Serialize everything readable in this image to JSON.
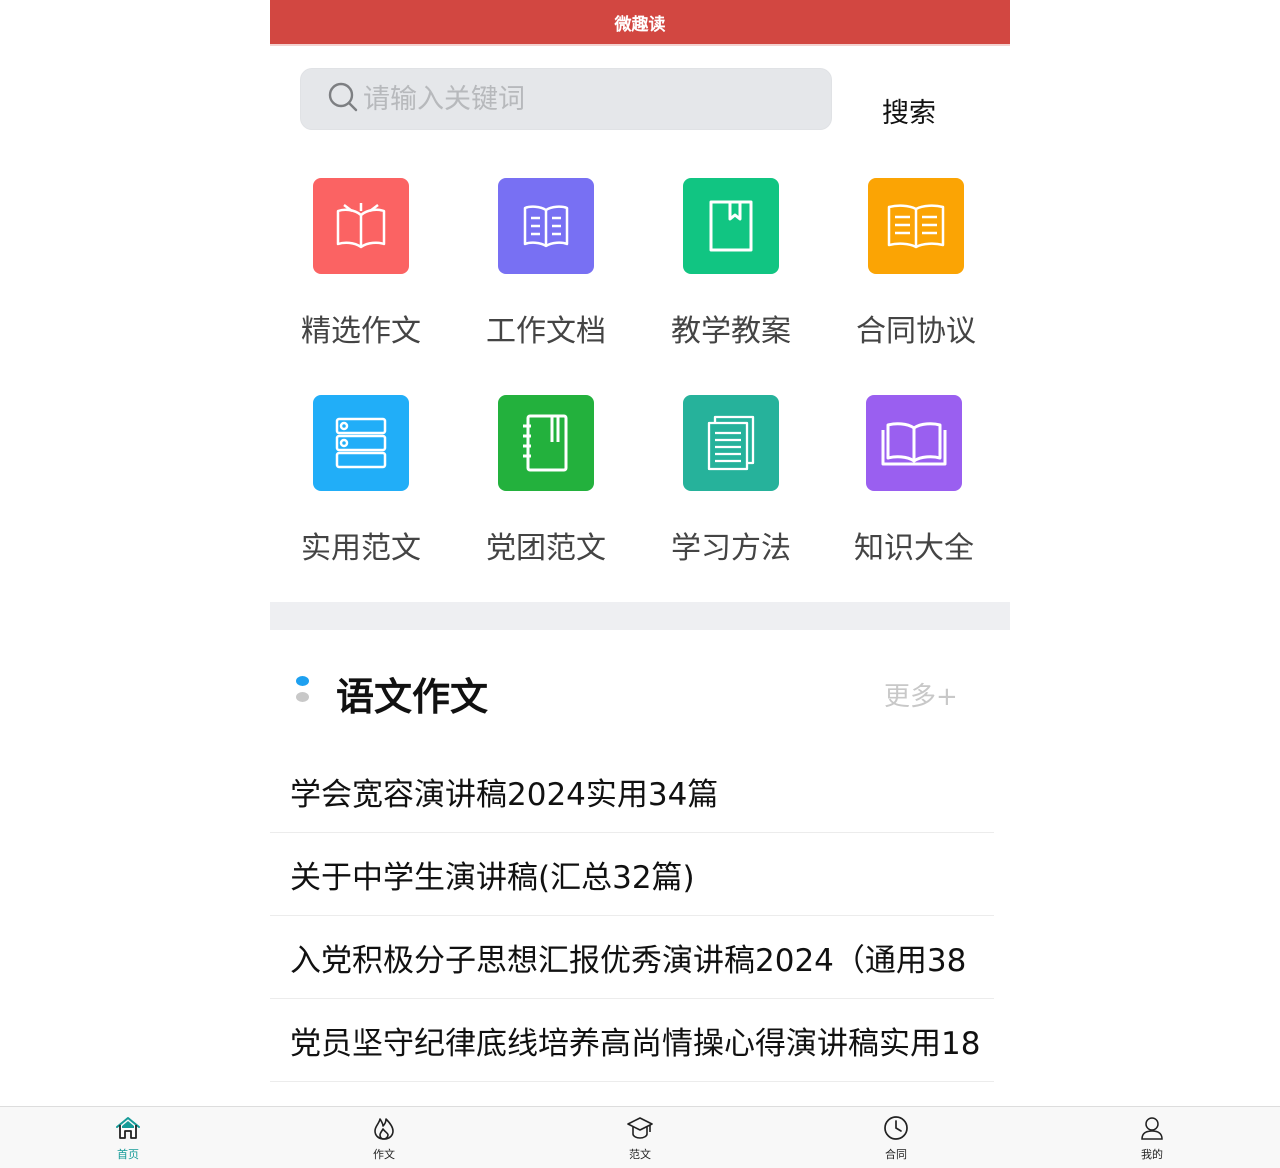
{
  "header": {
    "title": "微趣读"
  },
  "search": {
    "placeholder": "请输入关键词",
    "value": "",
    "button_label": "搜索"
  },
  "categories": [
    {
      "label": "精选作文",
      "icon": "open-book-icon",
      "color": "#fb6363"
    },
    {
      "label": "工作文档",
      "icon": "document-icon",
      "color": "#7870f3"
    },
    {
      "label": "教学教案",
      "icon": "bookmark-book-icon",
      "color": "#11c582"
    },
    {
      "label": "合同协议",
      "icon": "book-lines-icon",
      "color": "#fba404"
    },
    {
      "label": "实用范文",
      "icon": "server-list-icon",
      "color": "#21aef8"
    },
    {
      "label": "党团范文",
      "icon": "notebook-icon",
      "color": "#23b13d"
    },
    {
      "label": "学习方法",
      "icon": "paper-stack-icon",
      "color": "#26b29b"
    },
    {
      "label": "知识大全",
      "icon": "open-book-icon",
      "color": "#9a5ff0"
    }
  ],
  "section": {
    "title": "语文作文",
    "more_label": "更多+",
    "dot_colors": [
      "#1ea0f0",
      "#c8c8c8"
    ]
  },
  "articles": [
    "学会宽容演讲稿2024实用34篇",
    "关于中学生演讲稿(汇总32篇)",
    "入党积极分子思想汇报优秀演讲稿2024（通用38",
    "党员坚守纪律底线培养高尚情操心得演讲稿实用18"
  ],
  "tabbar": {
    "active_color": "#169b98",
    "items": [
      {
        "label": "首页",
        "icon": "home-icon",
        "active": true
      },
      {
        "label": "作文",
        "icon": "flame-icon",
        "active": false
      },
      {
        "label": "范文",
        "icon": "graduation-cap-icon",
        "active": false
      },
      {
        "label": "合同",
        "icon": "clock-icon",
        "active": false
      },
      {
        "label": "我的",
        "icon": "user-icon",
        "active": false
      }
    ]
  }
}
